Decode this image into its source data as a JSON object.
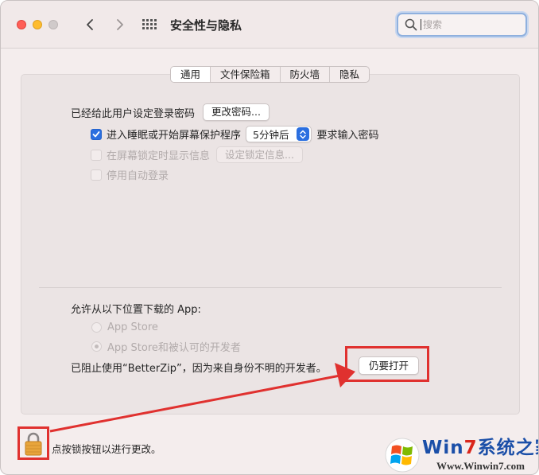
{
  "window": {
    "title": "安全性与隐私"
  },
  "search": {
    "placeholder": "搜索"
  },
  "tabs": [
    {
      "label": "通用",
      "active": true
    },
    {
      "label": "文件保险箱",
      "active": false
    },
    {
      "label": "防火墙",
      "active": false
    },
    {
      "label": "隐私",
      "active": false
    }
  ],
  "general": {
    "password_label": "已经给此用户设定登录密码",
    "change_password_button": "更改密码...",
    "require_password_prefix": "进入睡眠或开始屏幕保护程序",
    "require_password_delay": "5分钟后",
    "require_password_suffix": "要求输入密码",
    "show_message_label": "在屏幕锁定时显示信息",
    "set_lock_message_button": "设定锁定信息...",
    "disable_autologin_label": "停用自动登录"
  },
  "downloads": {
    "heading": "允许从以下位置下载的 App:",
    "option_app_store": "App Store",
    "option_app_store_dev": "App Store和被认可的开发者",
    "blocked_message": "已阻止使用“BetterZip”，因为来自身份不明的开发者。",
    "open_anyway_button": "仍要打开"
  },
  "footer": {
    "lock_label": "点按锁按钮以进行更改。"
  },
  "watermark": {
    "brand_part1": "Win",
    "brand_seven": "7",
    "brand_part2": "系统之家",
    "url": "Www.Winwin7.com"
  },
  "colors": {
    "accent": "#2b6fe0",
    "annotation": "#e0312f",
    "window_bg": "#f4eded"
  }
}
